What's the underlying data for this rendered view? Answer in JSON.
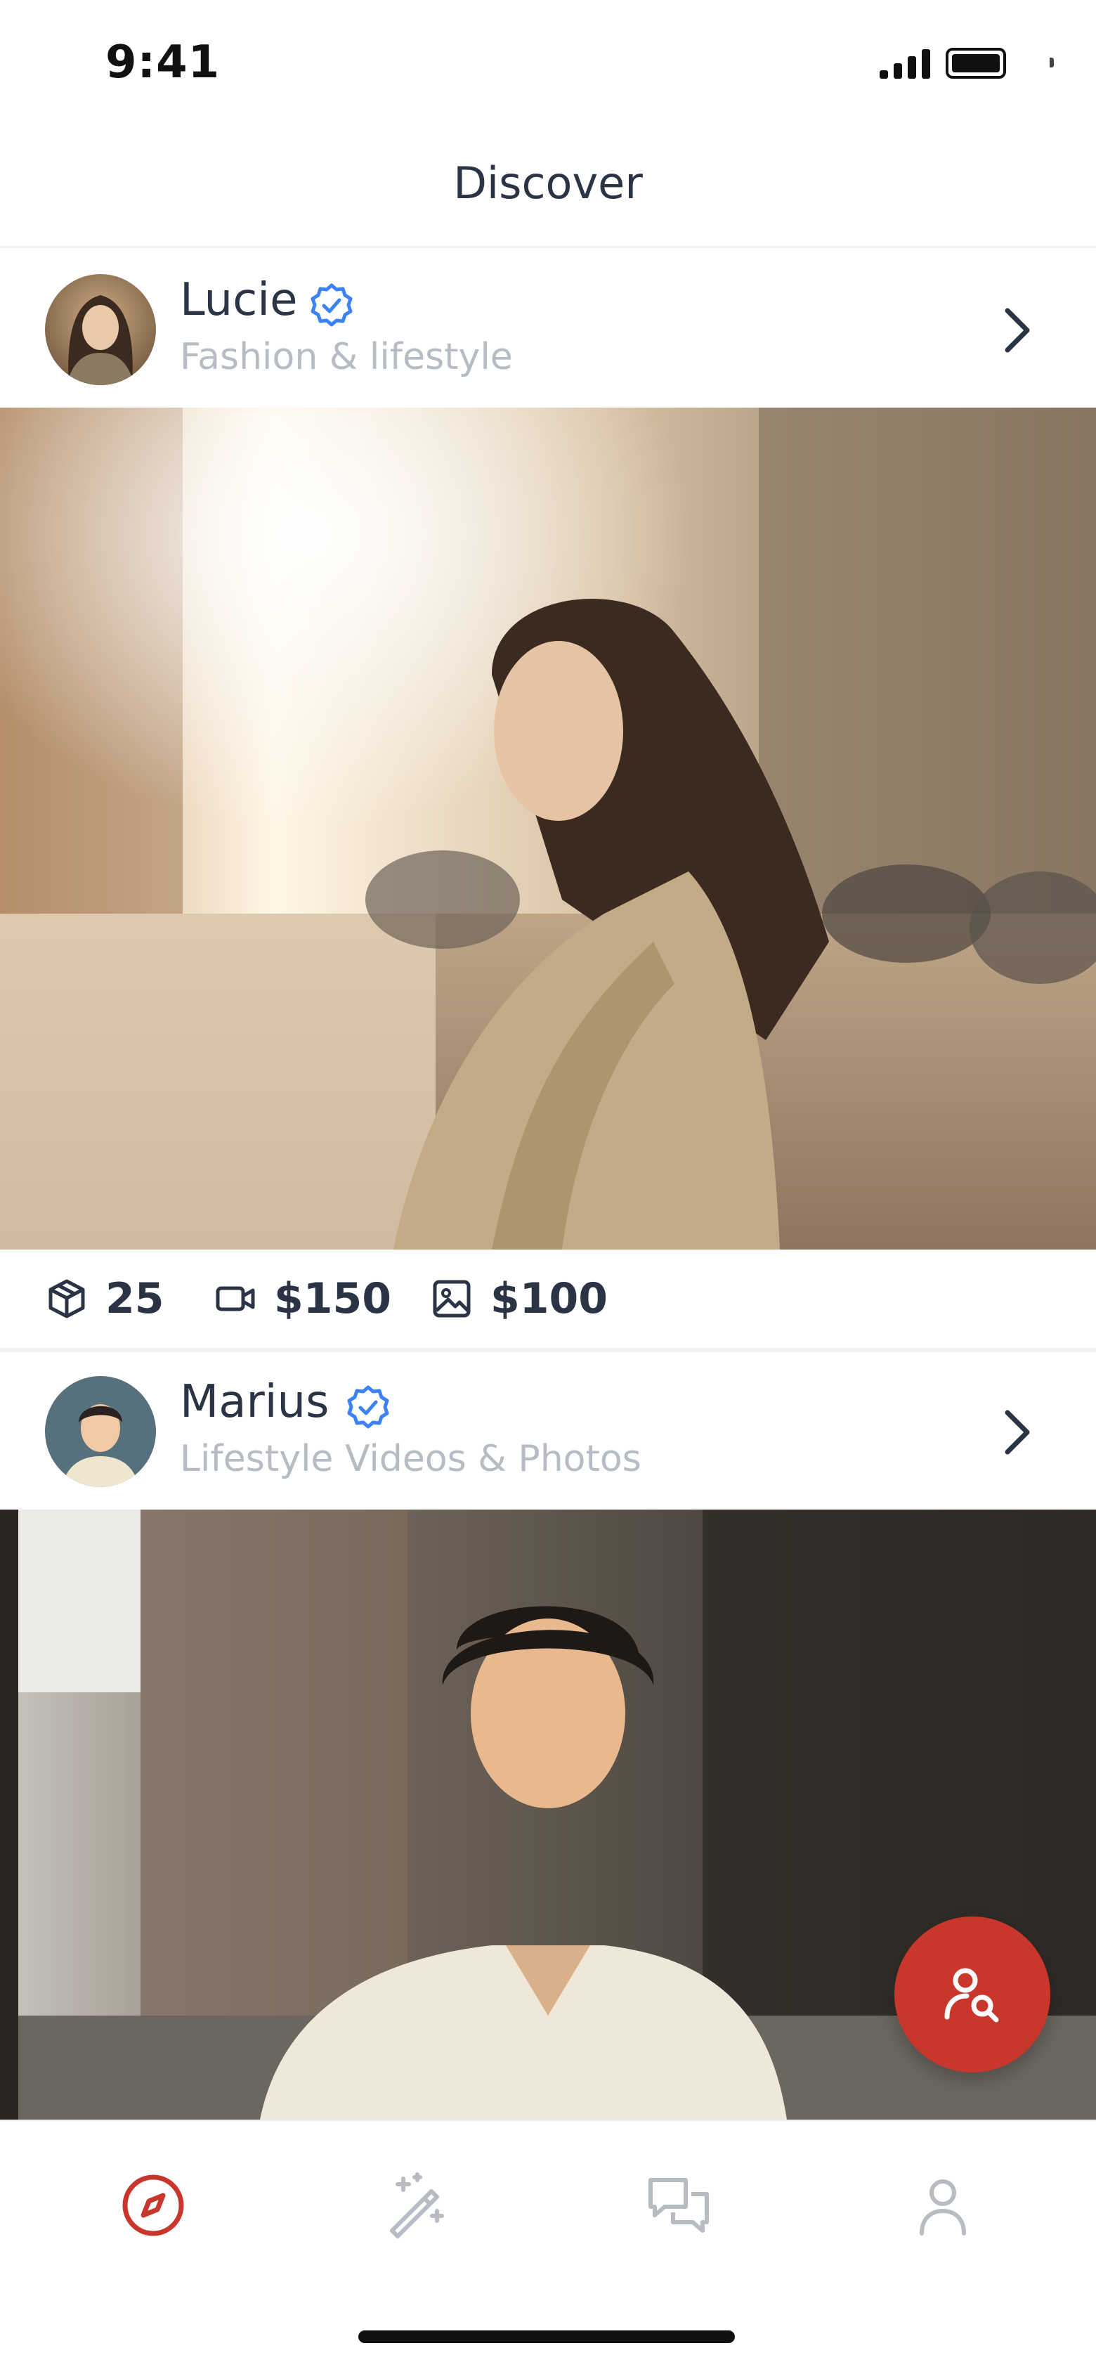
{
  "status_bar": {
    "time": "9:41"
  },
  "header": {
    "title": "Discover"
  },
  "creators": [
    {
      "name": "Lucie",
      "subtitle": "Fashion & lifestyle",
      "verified": true,
      "stats": {
        "items": "25",
        "video_price": "$150",
        "photo_price": "$100"
      }
    },
    {
      "name": "Marius",
      "subtitle": "Lifestyle Videos & Photos",
      "verified": true
    }
  ],
  "icons": {
    "verified": "verified-badge-icon",
    "chevron": "chevron-right-icon",
    "package": "package-icon",
    "video": "video-camera-icon",
    "image": "image-icon",
    "fab": "user-search-icon",
    "nav": [
      "compass-icon",
      "magic-wand-icon",
      "chat-icon",
      "profile-icon"
    ]
  },
  "colors": {
    "accent": "#c9372c",
    "verified": "#3b82f6",
    "text": "#2b3445",
    "muted": "#b7bcc4",
    "nav_inactive": "#b8bcc2"
  },
  "bottom_nav": {
    "active_index": 0
  }
}
